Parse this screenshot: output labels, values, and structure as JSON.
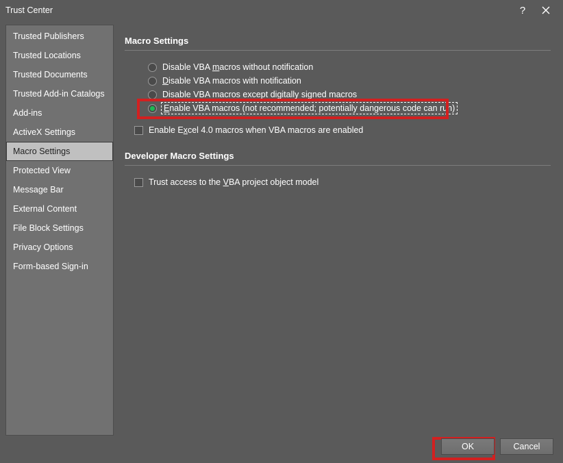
{
  "window": {
    "title": "Trust Center"
  },
  "sidebar": {
    "items": [
      {
        "label": "Trusted Publishers"
      },
      {
        "label": "Trusted Locations"
      },
      {
        "label": "Trusted Documents"
      },
      {
        "label": "Trusted Add-in Catalogs"
      },
      {
        "label": "Add-ins"
      },
      {
        "label": "ActiveX Settings"
      },
      {
        "label": "Macro Settings",
        "selected": true
      },
      {
        "label": "Protected View"
      },
      {
        "label": "Message Bar"
      },
      {
        "label": "External Content"
      },
      {
        "label": "File Block Settings"
      },
      {
        "label": "Privacy Options"
      },
      {
        "label": "Form-based Sign-in"
      }
    ]
  },
  "sections": {
    "macroSettings": {
      "heading": "Macro Settings",
      "radios": [
        {
          "checked": false,
          "pre": "Disable VBA ",
          "ul": "m",
          "post": "acros without notification"
        },
        {
          "checked": false,
          "pre": "",
          "ul": "D",
          "post": "isable VBA macros with notification"
        },
        {
          "checked": false,
          "pre": "Disable VBA macros except di",
          "ul": "g",
          "post": "itally signed macros"
        },
        {
          "checked": true,
          "pre": "",
          "ul": "E",
          "post": "nable VBA macros (not recommended; potentially dangerous code can run)",
          "highlighted": true
        }
      ],
      "excel4": {
        "checked": false,
        "pre": "Enable E",
        "ul": "x",
        "post": "cel 4.0 macros when VBA macros are enabled"
      }
    },
    "developerSettings": {
      "heading": "Developer Macro Settings",
      "trustAccess": {
        "checked": false,
        "pre": "Trust access to the ",
        "ul": "V",
        "post": "BA project object model"
      }
    }
  },
  "footer": {
    "ok": "OK",
    "cancel": "Cancel"
  }
}
